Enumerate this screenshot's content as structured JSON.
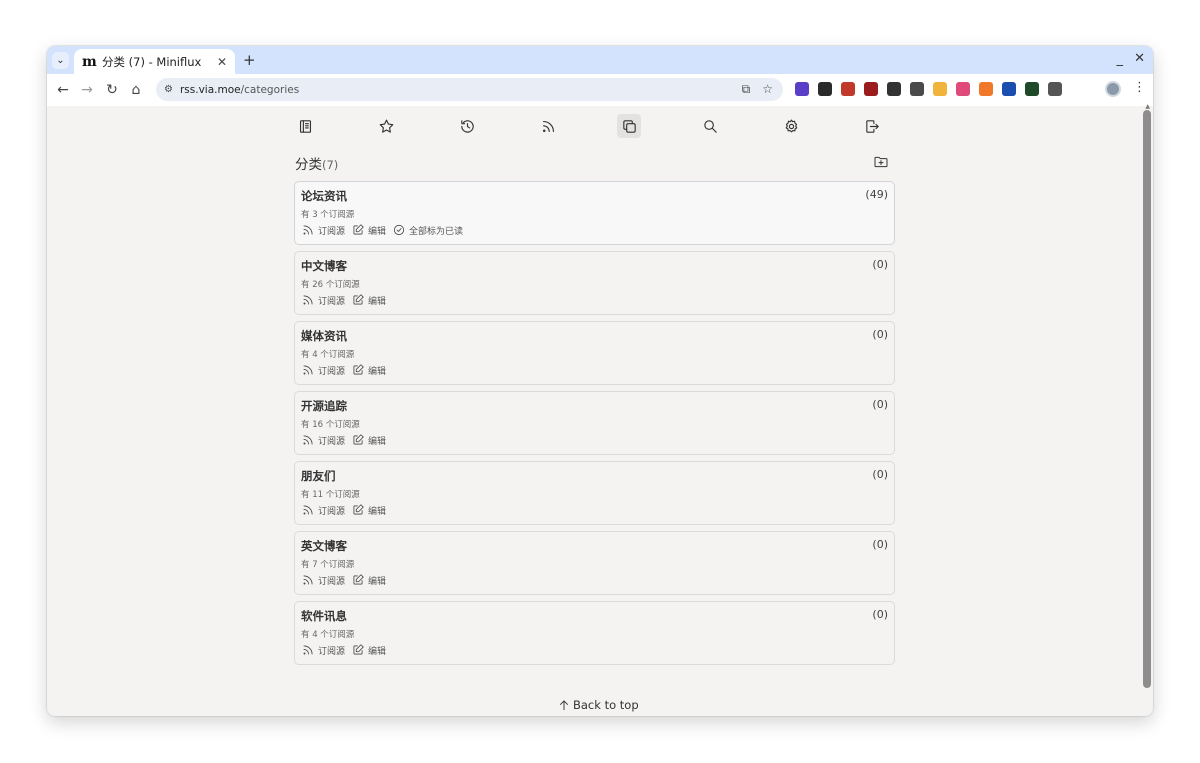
{
  "browser": {
    "tab_title": "分类 (7) - Miniflux",
    "tab_favicon": "m",
    "new_tab": "+",
    "tab_close": "✕",
    "minimize": "_",
    "close": "✕",
    "url_host": "rss.via.moe",
    "url_path": "/categories",
    "extensions": [
      {
        "name": "extension-purple-badge",
        "color": "#5b3ec8"
      },
      {
        "name": "extension-dark-f",
        "color": "#2b2b2b"
      },
      {
        "name": "extension-red-s",
        "color": "#c0392b"
      },
      {
        "name": "extension-red-badge",
        "color": "#9b1c1c"
      },
      {
        "name": "extension-dark-box",
        "color": "#333333"
      },
      {
        "name": "extension-clipboard",
        "color": "#4a4a4a"
      },
      {
        "name": "extension-yellow",
        "color": "#f0b43c"
      },
      {
        "name": "extension-pink",
        "color": "#e04a7a"
      },
      {
        "name": "extension-orange",
        "color": "#f07828"
      },
      {
        "name": "extension-blue",
        "color": "#1a4fb0"
      },
      {
        "name": "extension-green-terminal",
        "color": "#1f4a2a"
      },
      {
        "name": "extension-puzzle",
        "color": "#555555"
      }
    ]
  },
  "page": {
    "heading": "分类",
    "heading_count": "(7)",
    "categories": [
      {
        "title": "论坛资讯",
        "unread": "(49)",
        "feeds": "有 3 个订阅源",
        "feeds_label": "订阅源",
        "edit_label": "编辑",
        "mark_read_label": "全部标为已读"
      },
      {
        "title": "中文博客",
        "unread": "(0)",
        "feeds": "有 26 个订阅源",
        "feeds_label": "订阅源",
        "edit_label": "编辑"
      },
      {
        "title": "媒体资讯",
        "unread": "(0)",
        "feeds": "有 4 个订阅源",
        "feeds_label": "订阅源",
        "edit_label": "编辑"
      },
      {
        "title": "开源追踪",
        "unread": "(0)",
        "feeds": "有 16 个订阅源",
        "feeds_label": "订阅源",
        "edit_label": "编辑"
      },
      {
        "title": "朋友们",
        "unread": "(0)",
        "feeds": "有 11 个订阅源",
        "feeds_label": "订阅源",
        "edit_label": "编辑"
      },
      {
        "title": "英文博客",
        "unread": "(0)",
        "feeds": "有 7 个订阅源",
        "feeds_label": "订阅源",
        "edit_label": "编辑"
      },
      {
        "title": "软件讯息",
        "unread": "(0)",
        "feeds": "有 4 个订阅源",
        "feeds_label": "订阅源",
        "edit_label": "编辑"
      }
    ],
    "back_to_top": "Back to top"
  }
}
